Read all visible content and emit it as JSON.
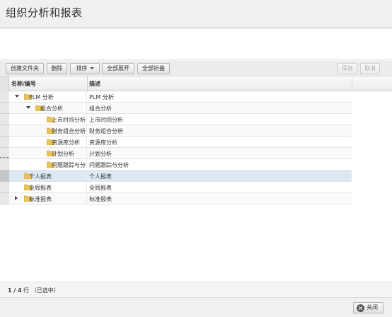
{
  "page": {
    "title": "组织分析和报表"
  },
  "toolbar": {
    "create_folder": "创建文件夹",
    "delete": "删除",
    "sort": "排序",
    "expand_all": "全部展开",
    "collapse_all": "全部折叠",
    "save": "保存",
    "cancel": "取消"
  },
  "grid": {
    "columns": [
      "名称/编号",
      "描述"
    ],
    "rows": [
      {
        "name": "PLM 分析",
        "desc": "PLM 分析",
        "level": 0,
        "expander": "open"
      },
      {
        "name": "组合分析",
        "desc": "组合分析",
        "level": 1,
        "expander": "open"
      },
      {
        "name": "上市时间分析",
        "desc": "上市时间分析",
        "level": 2,
        "expander": "none"
      },
      {
        "name": "财务组合分析",
        "desc": "财务组合分析",
        "level": 2,
        "expander": "none"
      },
      {
        "name": "资源库分析",
        "desc": "资源库分析",
        "level": 2,
        "expander": "none"
      },
      {
        "name": "计划分析",
        "desc": "计划分析",
        "level": 2,
        "expander": "none"
      },
      {
        "name": "问题跟踪与分析",
        "desc": "问题跟踪与分析",
        "level": 2,
        "expander": "none"
      },
      {
        "name": "个人报表",
        "desc": "个人报表",
        "level": 0,
        "expander": "none",
        "selected": true
      },
      {
        "name": "全局报表",
        "desc": "全局报表",
        "level": 0,
        "expander": "none"
      },
      {
        "name": "标准报表",
        "desc": "标准报表",
        "level": 0,
        "expander": "closed"
      }
    ]
  },
  "footer": {
    "count": "1 / 4",
    "suffix": " 行 （已选中）"
  },
  "dialog": {
    "close_label": "关闭"
  },
  "colors": {
    "folder": "#e8c25a",
    "folder_dark": "#c9a23a",
    "selected_row": "#dde8f5"
  }
}
